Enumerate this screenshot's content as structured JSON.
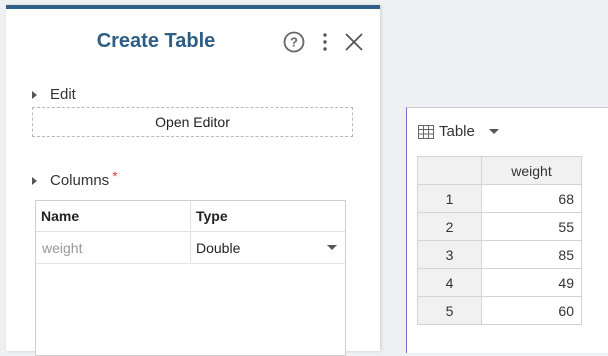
{
  "panel": {
    "title": "Create Table",
    "edit_label": "Edit",
    "open_editor_label": "Open Editor",
    "columns_label": "Columns",
    "required_mark": "*",
    "columns_table": {
      "headers": [
        "Name",
        "Type"
      ],
      "rows": [
        {
          "name_placeholder": "weight",
          "type": "Double"
        }
      ]
    },
    "icons": [
      "help-icon",
      "more-vertical-icon",
      "close-icon"
    ]
  },
  "preview": {
    "view_label": "Table",
    "column_header": "weight",
    "rows": [
      {
        "index": "1",
        "value": "68"
      },
      {
        "index": "2",
        "value": "55"
      },
      {
        "index": "3",
        "value": "85"
      },
      {
        "index": "4",
        "value": "49"
      },
      {
        "index": "5",
        "value": "60"
      }
    ]
  },
  "colors": {
    "title": "#2e5d85",
    "accent_bar": "#2f5e89",
    "required": "#d9443b"
  }
}
